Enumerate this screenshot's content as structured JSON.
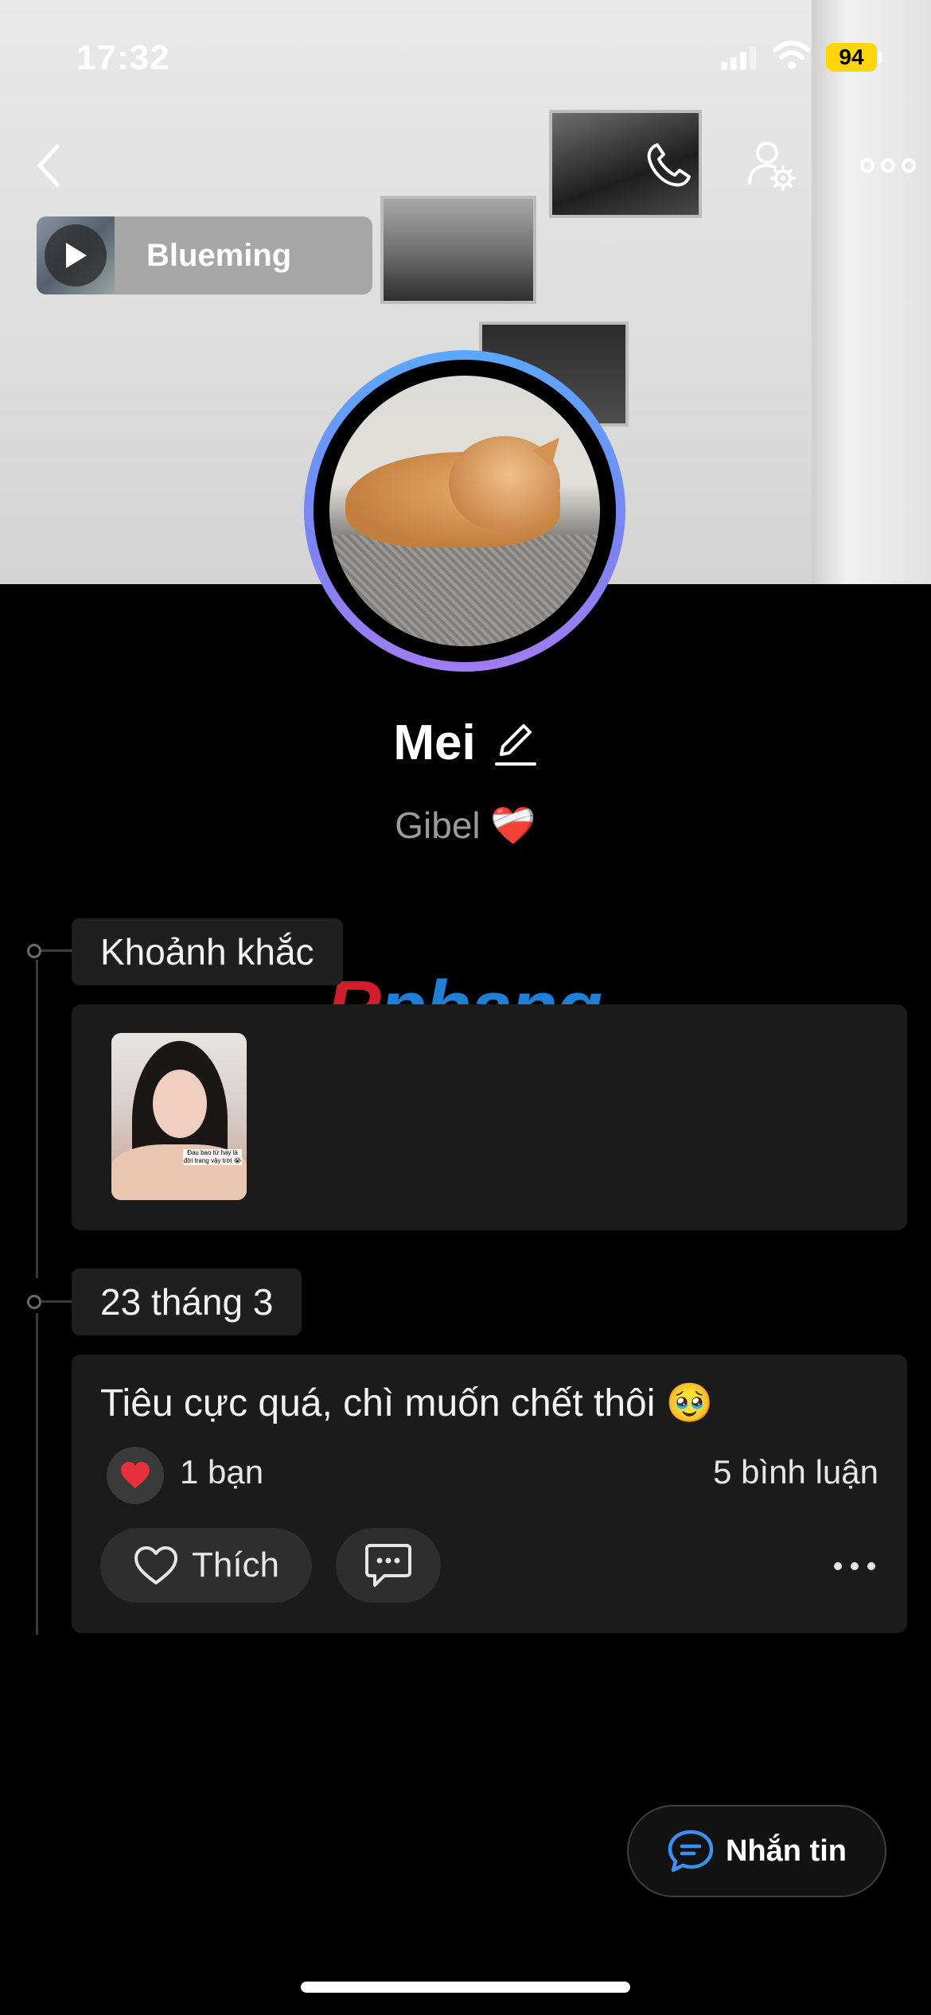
{
  "status_bar": {
    "time": "17:32",
    "battery": "94"
  },
  "music": {
    "title": "Blueming"
  },
  "profile": {
    "name": "Mei",
    "status": "Gibel ❤️‍🩹"
  },
  "timeline": [
    {
      "tag": "Khoảnh khắc"
    },
    {
      "tag": "23 tháng 3"
    }
  ],
  "moment": {
    "caption": "Đau bao từ hay là đời trang vậy trời 😭"
  },
  "post": {
    "text": "Tiêu cực quá, chì muốn chết thôi 🥹",
    "reactions": "1 bạn",
    "comments": "5 bình luận",
    "like_label": "Thích"
  },
  "watermark": {
    "r": "R",
    "rest": "phang"
  },
  "message_button": {
    "label": "Nhắn tin"
  },
  "colors": {
    "ring_top": "#5aa8ff",
    "ring_bottom": "#a27cf2",
    "battery": "#ffd60a",
    "background": "#000000"
  },
  "icons": [
    "back-icon",
    "phone-icon",
    "user-settings-icon",
    "more-icon",
    "play-icon",
    "edit-icon",
    "heart-icon",
    "comment-icon",
    "chat-icon"
  ]
}
